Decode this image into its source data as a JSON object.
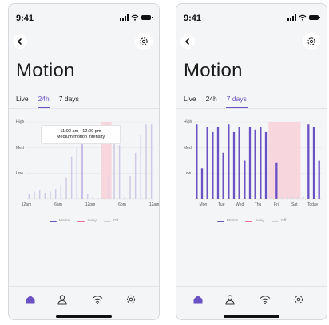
{
  "screens": [
    {
      "status": {
        "time": "9:41"
      },
      "title": "Motion",
      "tabs": [
        {
          "label": "Live",
          "active": false
        },
        {
          "label": "24h",
          "active": true
        },
        {
          "label": "7 days",
          "active": false
        }
      ],
      "tooltip": {
        "line1": "11:00 am - 12:00 pm",
        "line2": "Medium motion intensity"
      },
      "legend": [
        {
          "label": "Motion",
          "color": "#6a51c4"
        },
        {
          "label": "Away",
          "color": "#f06e8e"
        },
        {
          "label": "Off",
          "color": "#cfd1d6"
        }
      ]
    },
    {
      "status": {
        "time": "9:41"
      },
      "title": "Motion",
      "tabs": [
        {
          "label": "Live",
          "active": false
        },
        {
          "label": "24h",
          "active": false
        },
        {
          "label": "7 days",
          "active": true
        }
      ],
      "legend": [
        {
          "label": "Motion",
          "color": "#6a51c4"
        },
        {
          "label": "Away",
          "color": "#f06e8e"
        },
        {
          "label": "Off",
          "color": "#cfd1d6"
        }
      ]
    }
  ],
  "chart_data": [
    {
      "type": "bar",
      "x_ticks": [
        "12am",
        "6am",
        "12pm",
        "6pm",
        "12am"
      ],
      "y_ticks": [
        "High",
        "Med",
        "Low"
      ],
      "levels": {
        "Low": 1,
        "Med": 2,
        "High": 3
      },
      "x": [
        0.5,
        1.5,
        2.5,
        3.5,
        4.5,
        5.5,
        6.5,
        7.5,
        8.5,
        9.5,
        10.5,
        11.5,
        12.5,
        13.5,
        14.5,
        15.5,
        16.5,
        17.5,
        18.5,
        19.5,
        20.5,
        21.5,
        22.5,
        23.5
      ],
      "values": [
        0.22,
        0.3,
        0.35,
        0.25,
        0.3,
        0.4,
        0.55,
        0.85,
        1.65,
        2.0,
        2.55,
        0.2,
        0.12,
        0,
        0,
        0.9,
        2.2,
        2.1,
        0.1,
        0.9,
        1.8,
        2.5,
        2.9,
        2.9
      ],
      "selected_index": 10,
      "away_ranges": [
        [
          14,
          16
        ]
      ],
      "colors": {
        "bar": "#cfc9e6",
        "selected": "#b7aadf",
        "away": "#f8d6de"
      }
    },
    {
      "type": "bar",
      "x_ticks": [
        "Mon",
        "Tue",
        "Wed",
        "Thu",
        "Fri",
        "Sat",
        "Today"
      ],
      "y_ticks": [
        "High",
        "Med",
        "Low"
      ],
      "levels": {
        "Low": 1,
        "Med": 2,
        "High": 3
      },
      "values": [
        2.9,
        1.2,
        2.8,
        2.6,
        2.8,
        1.8,
        2.9,
        2.6,
        2.8,
        1.5,
        2.8,
        2.7,
        2.8,
        2.6,
        0.1,
        1.4,
        0.1,
        0.1,
        0.1,
        0.1,
        0.1,
        2.9,
        2.8,
        1.5
      ],
      "away_ranges": [
        [
          14,
          20
        ]
      ],
      "colors": {
        "bar": "#6a51c4",
        "off": "#d8dadf",
        "away": "#f8d6de"
      }
    }
  ]
}
